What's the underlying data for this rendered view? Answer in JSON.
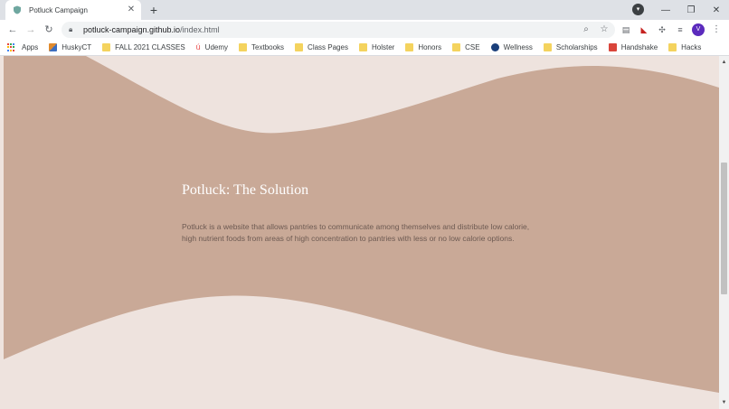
{
  "browser": {
    "tab_title": "Potluck Campaign",
    "tab_close": "✕",
    "new_tab": "+",
    "url_host": "potluck-campaign.github.io",
    "url_path": "/index.html",
    "profile_initial": "V",
    "window": {
      "minimize": "—",
      "restore": "❐",
      "close": "✕"
    }
  },
  "bookmarks": [
    {
      "label": "Apps",
      "icon": "apps-grid-icon"
    },
    {
      "label": "HuskyCT",
      "icon": "huskyct-icon"
    },
    {
      "label": "FALL 2021 CLASSES",
      "icon": "folder-icon"
    },
    {
      "label": "Udemy",
      "icon": "udemy-icon"
    },
    {
      "label": "Textbooks",
      "icon": "folder-icon"
    },
    {
      "label": "Class Pages",
      "icon": "folder-icon"
    },
    {
      "label": "Holster",
      "icon": "folder-icon"
    },
    {
      "label": "Honors",
      "icon": "folder-icon"
    },
    {
      "label": "CSE",
      "icon": "folder-icon"
    },
    {
      "label": "Wellness",
      "icon": "wellness-icon"
    },
    {
      "label": "Scholarships",
      "icon": "folder-icon"
    },
    {
      "label": "Handshake",
      "icon": "handshake-icon"
    },
    {
      "label": "Hacks",
      "icon": "folder-icon"
    }
  ],
  "page": {
    "section_title": "Potluck: The Solution",
    "section_body": "Potluck is a website that allows pantries to communicate among themselves and distribute low calorie, high nutrient foods from areas of high concentration to pantries with less or no low calorie options."
  },
  "colors": {
    "page_bg": "#eee3de",
    "wave": "#c9a997",
    "title": "#ffffff",
    "body_text": "#6d5a52",
    "chrome": "#dee1e6"
  }
}
